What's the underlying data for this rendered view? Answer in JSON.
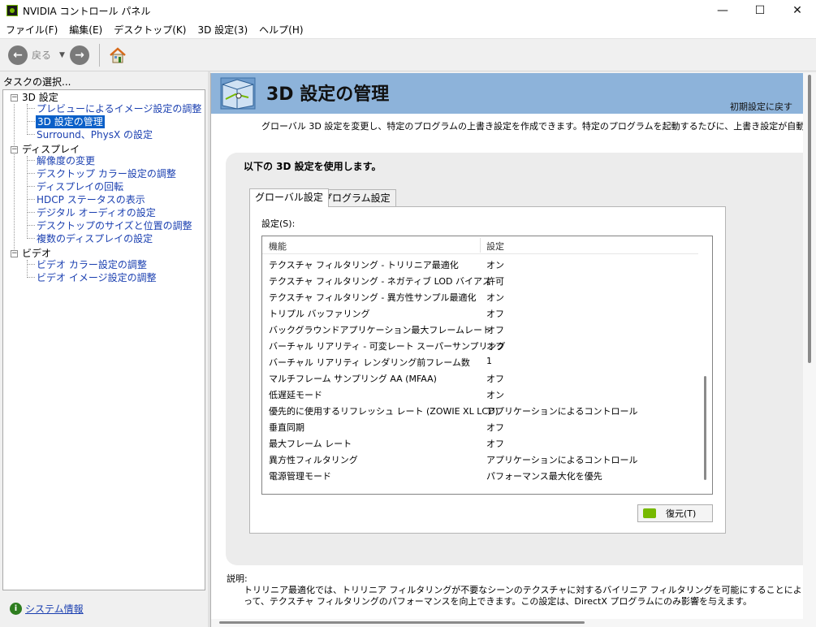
{
  "window": {
    "title": "NVIDIA コントロール パネル",
    "controls": {
      "minimize": "—",
      "maximize": "☐",
      "close": "✕"
    }
  },
  "menu": [
    "ファイル(F)",
    "編集(E)",
    "デスクトップ(K)",
    "3D 設定(3)",
    "ヘルプ(H)"
  ],
  "toolbar": {
    "back_label": "戻る",
    "back_glyph": "←",
    "forward_glyph": "→",
    "dropdown_glyph": "▼"
  },
  "sidebar": {
    "task_label": "タスクの選択...",
    "tree": {
      "cat_3d": "3D 設定",
      "item_preview": "プレビューによるイメージ設定の調整",
      "item_manage3d": "3D 設定の管理",
      "item_surround": "Surround、PhysX の設定",
      "cat_display": "ディスプレイ",
      "item_resolution": "解像度の変更",
      "item_color": "デスクトップ カラー設定の調整",
      "item_rotate": "ディスプレイの回転",
      "item_hdcp": "HDCP ステータスの表示",
      "item_audio": "デジタル オーディオの設定",
      "item_size": "デスクトップのサイズと位置の調整",
      "item_multi": "複数のディスプレイの設定",
      "cat_video": "ビデオ",
      "item_vcolor": "ビデオ カラー設定の調整",
      "item_vimage": "ビデオ イメージ設定の調整"
    },
    "toggle_glyph": "−",
    "system_info": "システム情報",
    "system_info_glyph": "i"
  },
  "main": {
    "title": "3D 設定の管理",
    "restore_defaults": "初期設定に戻す",
    "description": "グローバル 3D 設定を変更し、特定のプログラムの上書き設定を作成できます。特定のプログラムを起動するたびに、上書き設定が自動的に使用",
    "group_title": "以下の 3D 設定を使用します。",
    "tabs": {
      "global": "グローバル設定",
      "program": "プログラム設定"
    },
    "settings_label": "設定(S):",
    "columns": {
      "feature": "機能",
      "setting": "設定"
    },
    "rows": [
      {
        "feature": "テクスチャ フィルタリング - トリリニア最適化",
        "setting": "オン"
      },
      {
        "feature": "テクスチャ フィルタリング - ネガティブ LOD バイアス",
        "setting": "許可"
      },
      {
        "feature": "テクスチャ フィルタリング - 異方性サンプル最適化",
        "setting": "オン"
      },
      {
        "feature": "トリプル バッファリング",
        "setting": "オフ"
      },
      {
        "feature": "バックグラウンドアプリケーション最大フレームレート",
        "setting": "オフ"
      },
      {
        "feature": "バーチャル リアリティ - 可変レート スーパーサンプリング",
        "setting": "オフ"
      },
      {
        "feature": "バーチャル リアリティ レンダリング前フレーム数",
        "setting": "1"
      },
      {
        "feature": "マルチフレーム サンプリング AA (MFAA)",
        "setting": "オフ"
      },
      {
        "feature": "低遅延モード",
        "setting": "オン"
      },
      {
        "feature": "優先的に使用するリフレッシュ レート (ZOWIE XL LCD)",
        "setting": "アプリケーションによるコントロール"
      },
      {
        "feature": "垂直同期",
        "setting": "オフ"
      },
      {
        "feature": "最大フレーム レート",
        "setting": "オフ"
      },
      {
        "feature": "異方性フィルタリング",
        "setting": "アプリケーションによるコントロール"
      },
      {
        "feature": "電源管理モード",
        "setting": "パフォーマンス最大化を優先"
      }
    ],
    "restore_button": "復元(T)",
    "explain_label": "説明:",
    "explain_text": "トリリニア最適化では、トリリニア フィルタリングが不要なシーンのテクスチャに対するバイリニア フィルタリングを可能にすることによって、テクスチャ フィルタリングのパフォーマンスを向上できます。この設定は、DirectX プログラムにのみ影響を与えます。"
  },
  "colors": {
    "header_band": "#8db3da",
    "nvidia_green": "#76b900",
    "link": "#1a3fb0",
    "selected": "#0a5fc8"
  }
}
